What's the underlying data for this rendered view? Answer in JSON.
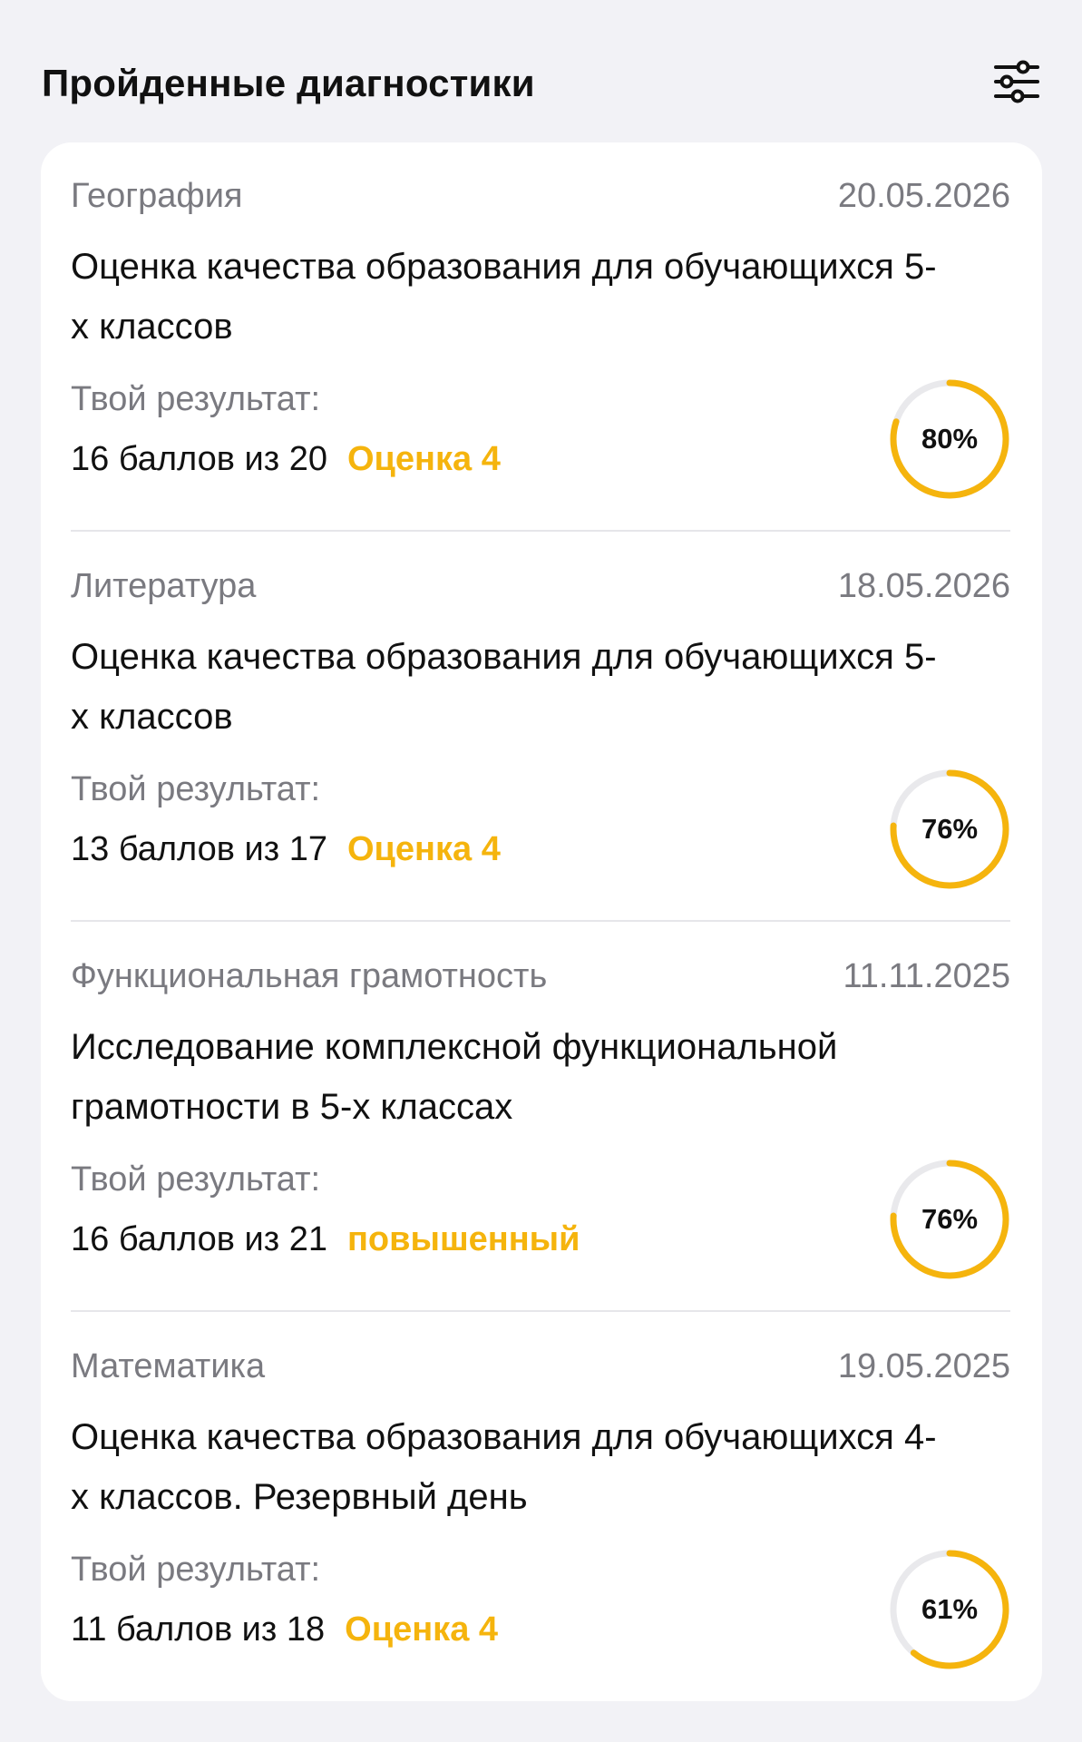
{
  "header": {
    "title": "Пройденные диагностики",
    "filter_icon": "sliders-filter-icon"
  },
  "colors": {
    "accent": "#F5B40D",
    "ring_track": "#E9E9EC",
    "muted_text": "#7A7A80",
    "background": "#F2F2F6"
  },
  "diagnostics": [
    {
      "subject": "География",
      "date": "20.05.2026",
      "title": "Оценка качества образования для обучающихся 5-х классов",
      "result_label": "Твой результат:",
      "score": "16 баллов из 20",
      "grade": "Оценка 4",
      "percent_label": "80%",
      "percent": 80
    },
    {
      "subject": "Литература",
      "date": "18.05.2026",
      "title": "Оценка качества образования для обучающихся 5-х классов",
      "result_label": "Твой результат:",
      "score": "13 баллов из 17",
      "grade": "Оценка 4",
      "percent_label": "76%",
      "percent": 76
    },
    {
      "subject": "Функциональная грамотность",
      "date": "11.11.2025",
      "title": "Исследование комплексной функциональной грамотности в 5-х классах",
      "result_label": "Твой результат:",
      "score": "16 баллов из 21",
      "grade": "повышенный",
      "percent_label": "76%",
      "percent": 76
    },
    {
      "subject": "Математика",
      "date": "19.05.2025",
      "title": "Оценка качества образования для обучающихся 4-х классов. Резервный день",
      "result_label": "Твой результат:",
      "score": "11 баллов из 18",
      "grade": "Оценка 4",
      "percent_label": "61%",
      "percent": 61
    }
  ]
}
